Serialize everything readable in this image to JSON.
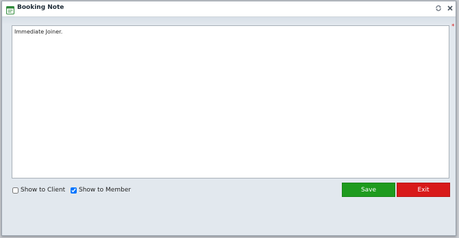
{
  "dialog": {
    "title": "Booking Note",
    "icons": {
      "title": "note-icon",
      "restore": "restore-icon",
      "close": "close-icon"
    }
  },
  "note": {
    "value": "Immediate Joiner.",
    "required_mark": "*"
  },
  "options": {
    "show_to_client": {
      "label": "Show to Client",
      "checked": false
    },
    "show_to_member": {
      "label": "Show to Member",
      "checked": true
    }
  },
  "buttons": {
    "save": {
      "label": "Save",
      "color": "#1e9b1e"
    },
    "exit": {
      "label": "Exit",
      "color": "#d81a1a"
    }
  },
  "colors": {
    "required": "#d81b1b",
    "dialog_bg": "#e2e8ee"
  }
}
